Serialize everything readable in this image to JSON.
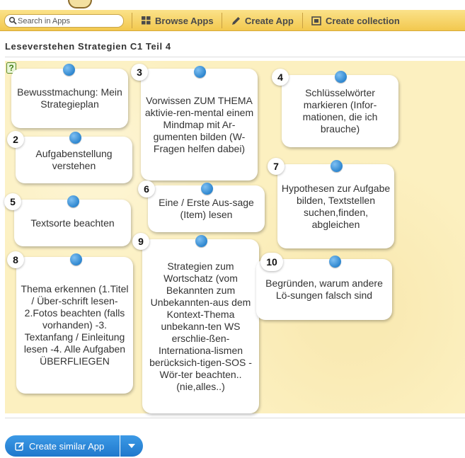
{
  "toolbar": {
    "search_placeholder": "Search in Apps",
    "browse_label": "Browse Apps",
    "create_app_label": "Create App",
    "create_collection_label": "Create collection"
  },
  "page_title": "Leseverstehen Strategien C1 Teil 4",
  "cards": [
    {
      "number": "",
      "text": "Bewusstmachung: Mein Strategieplan"
    },
    {
      "number": "2",
      "text": "Aufgabenstellung verstehen"
    },
    {
      "number": "3",
      "text": "Vorwissen ZUM THEMA aktivie-ren-mental einem Mindmap mit Ar-gumenten bilden (W-Fragen helfen dabei)"
    },
    {
      "number": "4",
      "text": "Schlüsselwörter markieren (Infor-mationen, die ich brauche)"
    },
    {
      "number": "5",
      "text": "Textsorte beachten"
    },
    {
      "number": "6",
      "text": "Eine / Erste Aus-sage (Item) lesen"
    },
    {
      "number": "7",
      "text": "Hypothesen zur Aufgabe bilden, Textstellen suchen,finden, abgleichen"
    },
    {
      "number": "8",
      "text": "Thema erkennen (1.Titel / Über-schrift lesen-2.Fotos beachten (falls vorhanden) -3. Textanfang / Einleitung lesen -4. Alle Aufgaben ÜBERFLIEGEN"
    },
    {
      "number": "9",
      "text": "Strategien zum Wortschatz (vom Bekannten zum Unbekannten-aus dem Kontext-Thema unbekann-ten WS erschlie-ßen-Internationa-lismen berücksich-tigen-SOS - Wör-ter beachten.. (nie,alles..)"
    },
    {
      "number": "10",
      "text": "Begründen, warum andere Lö-sungen falsch sind"
    }
  ],
  "footer": {
    "create_similar_label": "Create similar App"
  },
  "icons": {
    "help": "help-question-icon",
    "search": "search-icon",
    "browse": "grid-icon",
    "create": "pencil-icon",
    "collection": "collection-icon",
    "edit": "edit-icon",
    "dropdown": "caret-down-icon"
  }
}
